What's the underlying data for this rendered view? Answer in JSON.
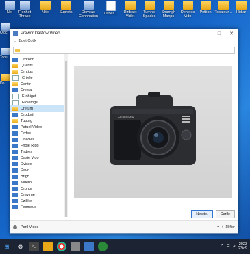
{
  "desktop": {
    "icons": [
      {
        "label": "Nel",
        "kind": "app"
      },
      {
        "label": "Fienhet Thrace",
        "kind": "app"
      },
      {
        "label": "Nite",
        "kind": "folder"
      },
      {
        "label": "Suprots",
        "kind": "folder"
      },
      {
        "label": "Dioveae Connnation",
        "kind": "app"
      },
      {
        "label": "Orbes...",
        "kind": "doc"
      },
      {
        "label": "Diribaet Videt",
        "kind": "folder"
      },
      {
        "label": "Tumnis Spades",
        "kind": "folder"
      },
      {
        "label": "Snamgh Manps",
        "kind": "folder"
      },
      {
        "label": "Deheles Vido",
        "kind": "folder"
      },
      {
        "label": "Pottion",
        "kind": "folder"
      },
      {
        "label": "Tosaldur...",
        "kind": "folder"
      },
      {
        "label": "Hidlar",
        "kind": "folder"
      }
    ],
    "left_icons": [
      {
        "label": "Otoc"
      },
      {
        "label": "Tocu"
      },
      {
        "label": "Do"
      }
    ]
  },
  "window": {
    "title": "Prewor Dastow Video",
    "menu": [
      "Bpet Cotlk"
    ],
    "tree_items": [
      {
        "label": "Orptoon",
        "icon": "file"
      },
      {
        "label": "Querits",
        "icon": "folder"
      },
      {
        "label": "Orntigs",
        "icon": "folder"
      },
      {
        "label": "Crilele",
        "icon": "doc"
      },
      {
        "label": "Conttr",
        "icon": "folder"
      },
      {
        "label": "Creola",
        "icon": "file"
      },
      {
        "label": "Erohiget",
        "icon": "doc"
      },
      {
        "label": "Froiemgs",
        "icon": "doc"
      },
      {
        "label": "Dretum",
        "icon": "folder",
        "selected": true
      },
      {
        "label": "Orodorit",
        "icon": "file"
      },
      {
        "label": "Tuporg",
        "icon": "folder"
      },
      {
        "label": "Patuel Video",
        "icon": "file"
      },
      {
        "label": "Ordes",
        "icon": "file"
      },
      {
        "label": "Oriecles",
        "icon": "file"
      },
      {
        "label": "Fnole Rido",
        "icon": "file"
      },
      {
        "label": "Tndres",
        "icon": "file"
      },
      {
        "label": "Dasie Vido",
        "icon": "file"
      },
      {
        "label": "Dvisee",
        "icon": "file"
      },
      {
        "label": "Dour",
        "icon": "file"
      },
      {
        "label": "Brigh",
        "icon": "file"
      },
      {
        "label": "Kidero",
        "icon": "file"
      },
      {
        "label": "Oronor",
        "icon": "file"
      },
      {
        "label": "Orevime",
        "icon": "file"
      },
      {
        "label": "Ezikke",
        "icon": "file"
      },
      {
        "label": "Feomoue",
        "icon": "file"
      }
    ],
    "camera_brand": "FUNIOMA",
    "buttons": {
      "primary": "Nestte.",
      "secondary": "Carlle"
    },
    "status": {
      "label": "Poril Vides",
      "zoom": "15fipr"
    }
  },
  "taskbar": {
    "clock_year": "2023",
    "clock_time": "23ic9"
  }
}
